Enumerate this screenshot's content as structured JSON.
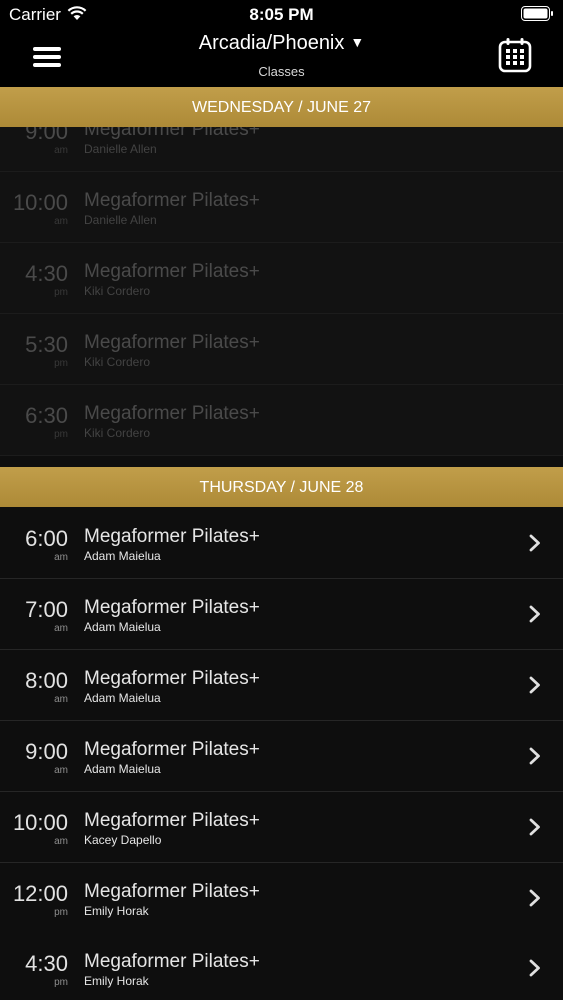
{
  "status_bar": {
    "carrier": "Carrier",
    "time": "8:05 PM"
  },
  "nav": {
    "title": "Arcadia/Phoenix",
    "caret": "▼",
    "subtitle": "Classes"
  },
  "sections": [
    {
      "header": "WEDNESDAY / JUNE 27",
      "past": true,
      "classes": [
        {
          "time": "9:00",
          "ampm": "am",
          "name": "Megaformer Pilates+",
          "instructor": "Danielle Allen"
        },
        {
          "time": "10:00",
          "ampm": "am",
          "name": "Megaformer Pilates+",
          "instructor": "Danielle Allen"
        },
        {
          "time": "4:30",
          "ampm": "pm",
          "name": "Megaformer Pilates+",
          "instructor": "Kiki Cordero"
        },
        {
          "time": "5:30",
          "ampm": "pm",
          "name": "Megaformer Pilates+",
          "instructor": "Kiki Cordero"
        },
        {
          "time": "6:30",
          "ampm": "pm",
          "name": "Megaformer Pilates+",
          "instructor": "Kiki Cordero"
        }
      ]
    },
    {
      "header": "THURSDAY / JUNE 28",
      "past": false,
      "classes": [
        {
          "time": "6:00",
          "ampm": "am",
          "name": "Megaformer Pilates+",
          "instructor": "Adam Maielua"
        },
        {
          "time": "7:00",
          "ampm": "am",
          "name": "Megaformer Pilates+",
          "instructor": "Adam Maielua"
        },
        {
          "time": "8:00",
          "ampm": "am",
          "name": "Megaformer Pilates+",
          "instructor": "Adam Maielua"
        },
        {
          "time": "9:00",
          "ampm": "am",
          "name": "Megaformer Pilates+",
          "instructor": "Adam Maielua"
        },
        {
          "time": "10:00",
          "ampm": "am",
          "name": "Megaformer Pilates+",
          "instructor": "Kacey Dapello"
        },
        {
          "time": "12:00",
          "ampm": "pm",
          "name": "Megaformer Pilates+",
          "instructor": "Emily Horak"
        },
        {
          "time": "4:30",
          "ampm": "pm",
          "name": "Megaformer Pilates+",
          "instructor": "Emily Horak"
        }
      ]
    }
  ],
  "icons": {
    "menu": "hamburger-menu-icon",
    "calendar": "calendar-icon",
    "row_action": "chevron-right-icon"
  },
  "colors": {
    "section_header": "#b8943f",
    "background": "#0e0e0e",
    "bar": "#000000"
  }
}
